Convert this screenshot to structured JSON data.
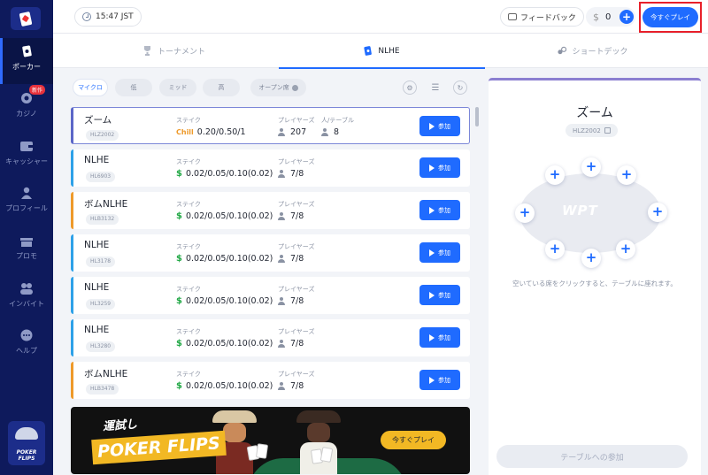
{
  "sidebar": {
    "items": [
      {
        "label": "ポーカー",
        "icon": "spade-card-icon",
        "active": true
      },
      {
        "label": "カジノ",
        "icon": "casino-chip-icon",
        "badge": "新作"
      },
      {
        "label": "キャッシャー",
        "icon": "wallet-icon"
      },
      {
        "label": "プロフィール",
        "icon": "user-icon"
      },
      {
        "label": "プロモ",
        "icon": "gift-icon"
      },
      {
        "label": "インバイト",
        "icon": "invite-icon"
      },
      {
        "label": "ヘルプ",
        "icon": "chat-help-icon"
      }
    ],
    "brand": {
      "line1": "POKER",
      "line2": "FLIPS"
    }
  },
  "topbar": {
    "time": "15:47 JST",
    "feedback_label": "フィードバック",
    "balance": "0",
    "currency_symbol": "$",
    "play_now_label": "今すぐプレイ"
  },
  "tabs": [
    {
      "label": "トーナメント",
      "icon": "trophy-icon",
      "active": false
    },
    {
      "label": "NLHE",
      "icon": "card-icon",
      "active": true
    },
    {
      "label": "ショートデック",
      "icon": "cards-icon",
      "active": false
    }
  ],
  "filters": [
    {
      "label": "マイクロ",
      "active": true
    },
    {
      "label": "低",
      "active": false
    },
    {
      "label": "ミッド",
      "active": false
    },
    {
      "label": "高",
      "active": false
    },
    {
      "label": "オープン席",
      "active": false
    }
  ],
  "columns": {
    "stakes": "ステイク",
    "players": "プレイヤーズ",
    "per_table": "人/テーブル"
  },
  "join_label": "参加",
  "rows": [
    {
      "name": "ズーム",
      "code": "HLZ2002",
      "currency": "Chill",
      "stakes": "0.20/0.50/1",
      "players": "207",
      "seats": "8",
      "selected": true
    },
    {
      "name": "NLHE",
      "code": "HL6903",
      "currency": "$",
      "stakes": "0.02/0.05/0.10(0.02)",
      "players": "7/8"
    },
    {
      "name": "ボムNLHE",
      "code": "HLB3132",
      "currency": "$",
      "stakes": "0.02/0.05/0.10(0.02)",
      "players": "7/8",
      "orange": true
    },
    {
      "name": "NLHE",
      "code": "HL3178",
      "currency": "$",
      "stakes": "0.02/0.05/0.10(0.02)",
      "players": "7/8"
    },
    {
      "name": "NLHE",
      "code": "HL3259",
      "currency": "$",
      "stakes": "0.02/0.05/0.10(0.02)",
      "players": "7/8"
    },
    {
      "name": "NLHE",
      "code": "HL3280",
      "currency": "$",
      "stakes": "0.02/0.05/0.10(0.02)",
      "players": "7/8"
    },
    {
      "name": "ボムNLHE",
      "code": "HLB3478",
      "currency": "$",
      "stakes": "0.02/0.05/0.10(0.02)",
      "players": "7/8",
      "orange": true
    }
  ],
  "banner": {
    "tagline": "運試し",
    "title": "POKER FLIPS",
    "button": "今すぐプレイ"
  },
  "panel": {
    "title": "ズーム",
    "code": "HLZ2002",
    "table_logo": "WPT",
    "seat_symbol": "+",
    "hint": "空いている席をクリックすると、テーブルに座れます。",
    "join_button": "テーブルへの参加"
  }
}
